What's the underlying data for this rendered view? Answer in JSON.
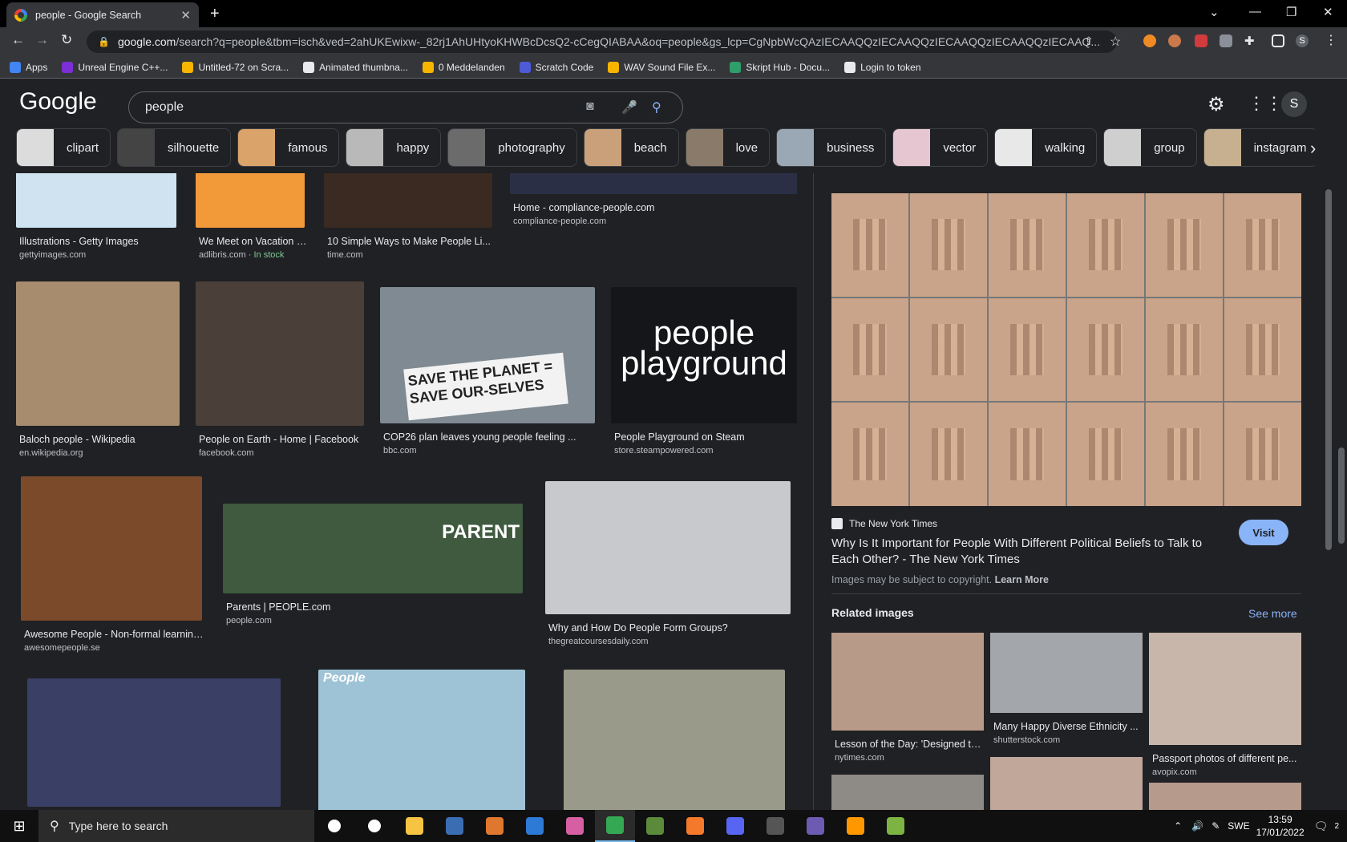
{
  "browser": {
    "tab_title": "people - Google Search",
    "url_host": "google.com",
    "url_path": "/search?q=people&tbm=isch&ved=2ahUKEwixw-_82rj1AhUHtyoKHWBcDcsQ2-cCegQIABAA&oq=people&gs_lcp=CgNpbWcQAzIECAAQQzIECAAQQzIECAAQQzIECAAQQzIECAAQ...",
    "profile_initial": "S"
  },
  "bookmarks": [
    {
      "label": "Apps",
      "color": "#4285f4"
    },
    {
      "label": "Unreal Engine C++...",
      "color": "#7b2fd4"
    },
    {
      "label": "Untitled-72 on Scra...",
      "color": "#f7b500"
    },
    {
      "label": "Animated thumbna...",
      "color": "#e8eaed"
    },
    {
      "label": "0 Meddelanden",
      "color": "#f7b500"
    },
    {
      "label": "Scratch Code",
      "color": "#4d5bd6"
    },
    {
      "label": "WAV Sound File Ex...",
      "color": "#f7b500"
    },
    {
      "label": "Skript Hub - Docu...",
      "color": "#2e9e6b"
    },
    {
      "label": "Login to token",
      "color": "#e8eaed"
    }
  ],
  "google": {
    "logo": "Google",
    "query": "people",
    "avatar_initial": "S"
  },
  "chips": [
    {
      "label": "clipart",
      "color": "#dcdcdc"
    },
    {
      "label": "silhouette",
      "color": "#444444"
    },
    {
      "label": "famous",
      "color": "#d9a36a"
    },
    {
      "label": "happy",
      "color": "#b9b9b9"
    },
    {
      "label": "photography",
      "color": "#6b6b6b"
    },
    {
      "label": "beach",
      "color": "#c9a07a"
    },
    {
      "label": "love",
      "color": "#8a7a6a"
    },
    {
      "label": "business",
      "color": "#9aa7b5"
    },
    {
      "label": "vector",
      "color": "#e6c6d0"
    },
    {
      "label": "walking",
      "color": "#e8e8e8"
    },
    {
      "label": "group",
      "color": "#cfcfcf"
    },
    {
      "label": "instagram",
      "color": "#c7b090"
    }
  ],
  "results": [
    {
      "title": "Illustrations - Getty Images",
      "site": "gettyimages.com",
      "stock": "",
      "color": "#cfe3f0"
    },
    {
      "title": "We Meet on Vacation - ...",
      "site": "adlibris.com · ",
      "stock": "In stock",
      "color": "#f29a3a"
    },
    {
      "title": "10 Simple Ways to Make People Li...",
      "site": "time.com",
      "stock": "",
      "color": "#3a2a22"
    },
    {
      "title": "Home - compliance-people.com",
      "site": "compliance-people.com",
      "stock": "",
      "color": "#2a2f45"
    },
    {
      "title": "Baloch people - Wikipedia",
      "site": "en.wikipedia.org",
      "stock": "",
      "color": "#a78c6e"
    },
    {
      "title": "People on Earth - Home | Facebook",
      "site": "facebook.com",
      "stock": "",
      "color": "#4b3f3a"
    },
    {
      "title": "COP26 plan leaves young people feeling ...",
      "site": "bbc.com",
      "stock": "",
      "color": "#7f8a93"
    },
    {
      "title": "People Playground on Steam",
      "site": "store.steampowered.com",
      "stock": "",
      "color": "#15161a"
    },
    {
      "title": "Awesome People - Non-formal learning ...",
      "site": "awesomepeople.se",
      "stock": "",
      "color": "#7a4a2a"
    },
    {
      "title": "Parents | PEOPLE.com",
      "site": "people.com",
      "stock": "",
      "color": "#3f5a3f"
    },
    {
      "title": "Why and How Do People Form Groups?",
      "site": "thegreatcoursesdaily.com",
      "stock": "",
      "color": "#c7c9cc"
    },
    {
      "title": "",
      "site": "",
      "stock": "",
      "color": "#3a3f66"
    },
    {
      "title": "",
      "site": "",
      "stock": "",
      "color": "#9fc3d6"
    },
    {
      "title": "",
      "site": "",
      "stock": "",
      "color": "#9a9a8a"
    }
  ],
  "overlays": {
    "playground_text": "people playground",
    "sign_text": "SAVE THE PLANET = SAVE OUR-SELVES",
    "parent_text": "PARENT",
    "people_logo": "People"
  },
  "panel": {
    "source": "The New York Times",
    "title": "Why Is It Important for People With Different Political Beliefs to Talk to Each Other? - The New York Times",
    "visit": "Visit",
    "copyright": "Images may be subject to copyright.",
    "learn_more": "Learn More",
    "related_heading": "Related images",
    "see_more": "See more",
    "related": [
      {
        "title": "Lesson of the Day: 'Designed to...",
        "site": "nytimes.com",
        "color": "#b89a88"
      },
      {
        "title": "Many Happy Diverse Ethnicity ...",
        "site": "shutterstock.com",
        "color": "#a3a6ab"
      },
      {
        "title": "Passport photos of different pe...",
        "site": "avopix.com",
        "color": "#c8b6aa"
      },
      {
        "title": "",
        "site": "",
        "color": "#8e8a86"
      },
      {
        "title": "",
        "site": "",
        "color": "#c0a79a"
      },
      {
        "title": "",
        "site": "",
        "color": "#b69a8c"
      }
    ]
  },
  "taskbar": {
    "search_placeholder": "Type here to search",
    "lang": "SWE",
    "time": "13:59",
    "date": "17/01/2022",
    "notif_count": "2",
    "apps": [
      {
        "name": "cortana",
        "color": "#ffffff"
      },
      {
        "name": "task-view",
        "color": "#ffffff"
      },
      {
        "name": "file-explorer",
        "color": "#f6c343"
      },
      {
        "name": "vr-app",
        "color": "#3b6db3"
      },
      {
        "name": "krita",
        "color": "#e0772f"
      },
      {
        "name": "store",
        "color": "#2d7ad6"
      },
      {
        "name": "paint-app",
        "color": "#d65fa3"
      },
      {
        "name": "chrome",
        "color": "#34a853"
      },
      {
        "name": "minecraft",
        "color": "#5b8a3a"
      },
      {
        "name": "blender",
        "color": "#f5792a"
      },
      {
        "name": "discord",
        "color": "#5865f2"
      },
      {
        "name": "terminal",
        "color": "#555555"
      },
      {
        "name": "unknown-app",
        "color": "#6d5bb3"
      },
      {
        "name": "sublime-text",
        "color": "#ff9800"
      },
      {
        "name": "notepad-plus",
        "color": "#7cb342"
      }
    ]
  }
}
